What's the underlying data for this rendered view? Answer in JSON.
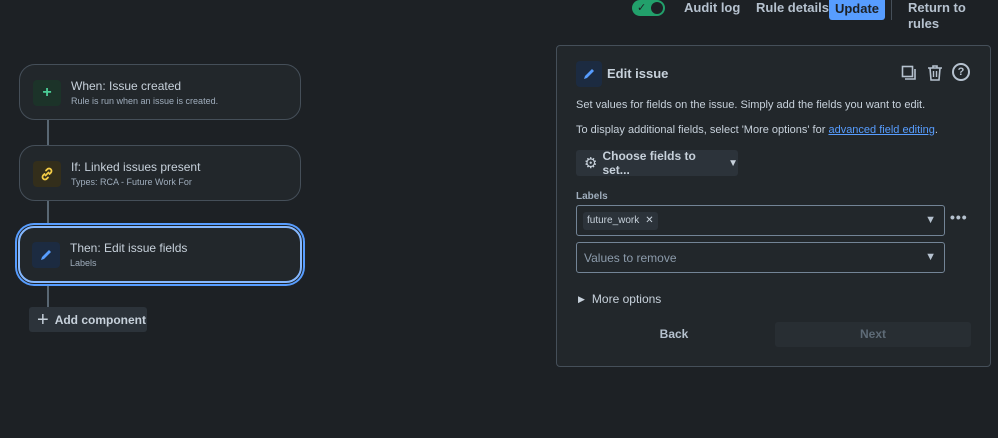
{
  "topbar": {
    "toggle_state": "on",
    "audit_log": "Audit log",
    "rule_details": "Rule details",
    "update": "Update",
    "return_to_rules": "Return to rules"
  },
  "flow": {
    "nodes": [
      {
        "title": "When: Issue created",
        "subtitle": "Rule is run when an issue is created.",
        "icon": "plus-icon"
      },
      {
        "title": "If: Linked issues present",
        "subtitle": "Types: RCA - Future Work For",
        "icon": "link-icon"
      },
      {
        "title": "Then: Edit issue fields",
        "subtitle": "Labels",
        "icon": "pencil-icon",
        "selected": true
      }
    ],
    "add_component": "Add component"
  },
  "panel": {
    "title": "Edit issue",
    "description1": "Set values for fields on the issue. Simply add the fields you want to edit.",
    "description2_prefix": "To display additional fields, select 'More options' for ",
    "description2_link": "advanced field editing",
    "description2_suffix": ".",
    "choose_fields": "Choose fields to set...",
    "labels_label": "Labels",
    "labels_value_chip": "future_work",
    "remove_placeholder": "Values to remove",
    "more_options": "More options",
    "back": "Back",
    "next": "Next"
  },
  "colors": {
    "accent": "#579dff",
    "toggle_on": "#22a06b",
    "background": "#1d2125",
    "surface": "#22272b"
  }
}
